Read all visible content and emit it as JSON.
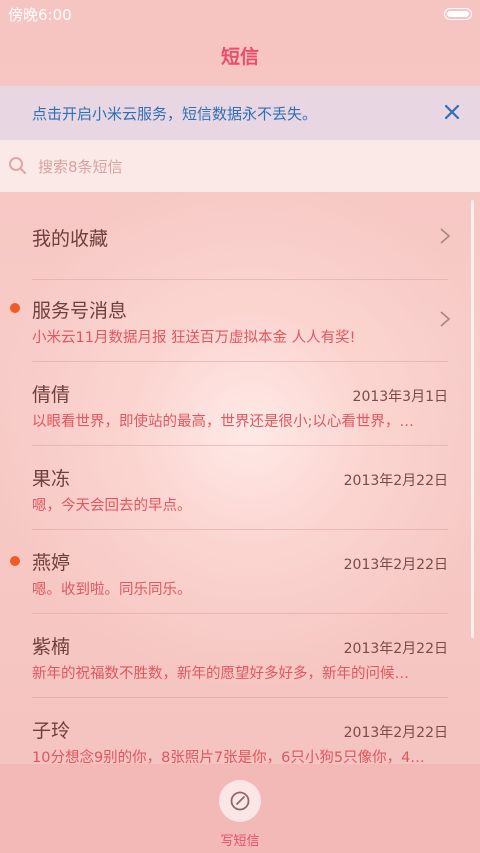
{
  "status": {
    "time": "傍晚6:00"
  },
  "header": {
    "title": "短信"
  },
  "banner": {
    "text": "点击开启小米云服务，短信数据永不丢失。"
  },
  "search": {
    "placeholder": "搜索8条短信"
  },
  "favorites": {
    "label": "我的收藏"
  },
  "service": {
    "title": "服务号消息",
    "subtitle": "小米云11月数据月报 狂送百万虚拟本金 人人有奖!"
  },
  "messages": [
    {
      "name": "倩倩",
      "date": "2013年3月1日",
      "preview": "以眼看世界，即使站的最高，世界还是很小;以心看世界，…",
      "unread": false
    },
    {
      "name": "果冻",
      "date": "2013年2月22日",
      "preview": "嗯，今天会回去的早点。",
      "unread": false
    },
    {
      "name": "燕婷",
      "date": "2013年2月22日",
      "preview": "嗯。收到啦。同乐同乐。",
      "unread": true
    },
    {
      "name": "紫楠",
      "date": "2013年2月22日",
      "preview": "新年的祝福数不胜数，新年的愿望好多好多，新年的问候…",
      "unread": false
    },
    {
      "name": "子玲",
      "date": "2013年2月22日",
      "preview": "10分想念9别的你，8张照片7张是你，6只小狗5只像你，4…",
      "unread": false
    }
  ],
  "bottom": {
    "compose_label": "写短信"
  },
  "colors": {
    "accent": "#e8506a",
    "unread_dot": "#f05a24",
    "banner_text": "#2f6fb7"
  }
}
